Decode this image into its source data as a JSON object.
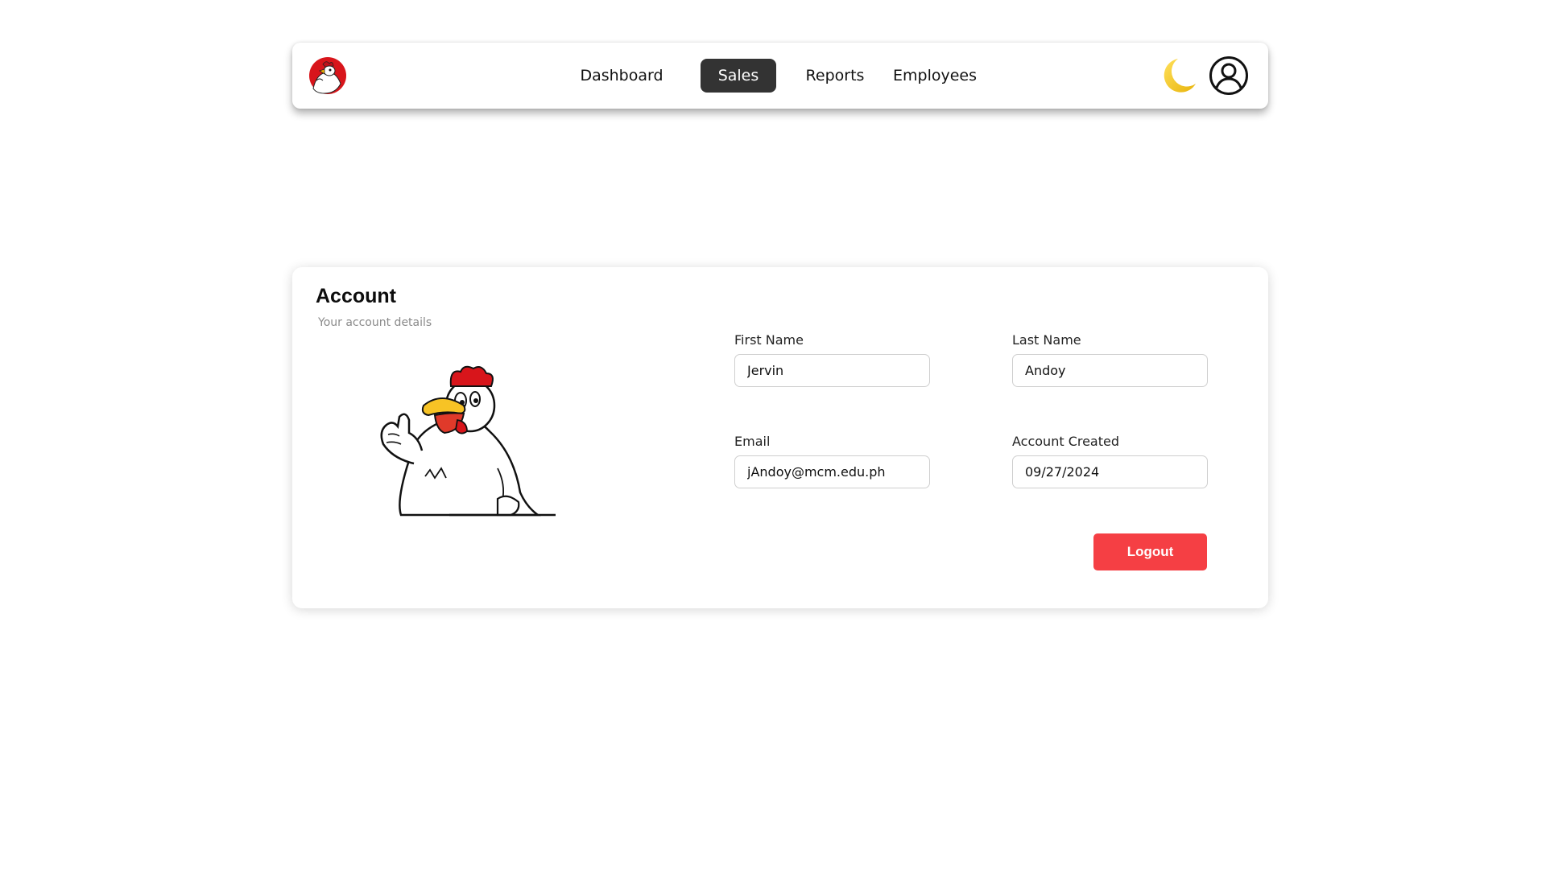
{
  "navbar": {
    "links": [
      {
        "label": "Dashboard",
        "active": false
      },
      {
        "label": "Sales",
        "active": true
      },
      {
        "label": "Reports",
        "active": false
      },
      {
        "label": "Employees",
        "active": false
      }
    ],
    "logo_icon": "chicken-logo-icon",
    "theme_icon": "moon-icon",
    "profile_icon": "user-circle-icon"
  },
  "account": {
    "title": "Account",
    "subtitle": "Your account details",
    "mascot_icon": "chicken-mascot-icon",
    "fields": {
      "first_name": {
        "label": "First Name",
        "value": "Jervin"
      },
      "last_name": {
        "label": "Last Name",
        "value": "Andoy"
      },
      "email": {
        "label": "Email",
        "value": "jAndoy@mcm.edu.ph"
      },
      "account_created": {
        "label": "Account Created",
        "value": "09/27/2024"
      }
    },
    "logout_label": "Logout"
  },
  "colors": {
    "active_nav_bg": "#333333",
    "logout_bg": "#f53f44",
    "moon": "#f5c518",
    "logo_red": "#d8151b"
  }
}
